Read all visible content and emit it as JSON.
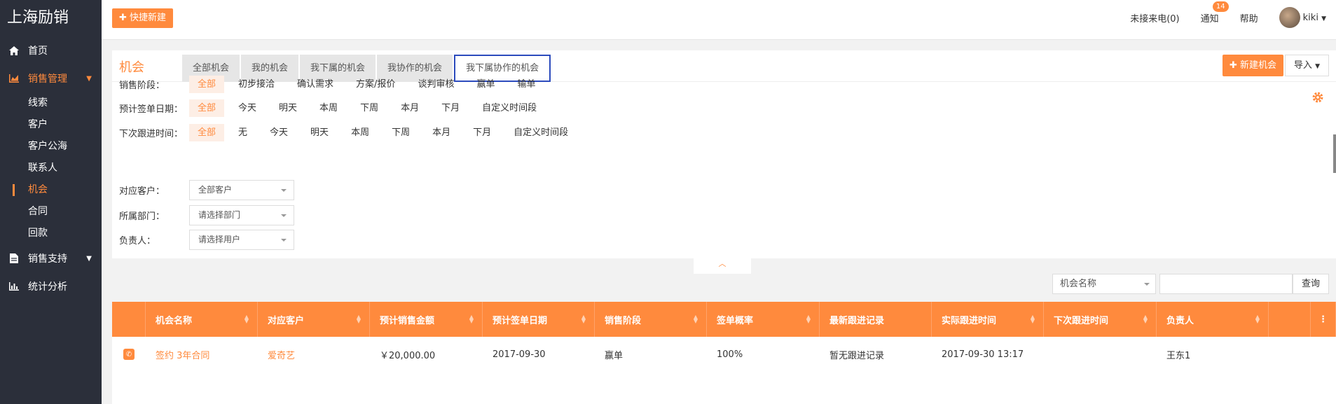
{
  "app": {
    "brand": "上海励销"
  },
  "sidebar": {
    "items": [
      {
        "label": "首页",
        "icon": "home-icon"
      },
      {
        "label": "销售管理",
        "icon": "chart-area-icon"
      },
      {
        "label": "销售支持",
        "icon": "document-icon"
      },
      {
        "label": "统计分析",
        "icon": "bar-chart-icon"
      }
    ],
    "sub_items": [
      "线索",
      "客户",
      "客户公海",
      "联系人",
      "机会",
      "合同",
      "回款"
    ]
  },
  "header": {
    "quick_new": "快捷新建",
    "missed_calls": "未接来电(0)",
    "notice": "通知",
    "notice_count": "14",
    "help": "帮助",
    "user": "kiki"
  },
  "panel": {
    "title": "机会",
    "tabs": [
      "全部机会",
      "我的机会",
      "我下属的机会",
      "我协作的机会",
      "我下属协作的机会"
    ],
    "new_button": "新建机会",
    "import_button": "导入"
  },
  "filters": {
    "stage": {
      "label": "销售阶段：",
      "options": [
        "全部",
        "初步接洽",
        "确认需求",
        "方案/报价",
        "谈判审核",
        "赢单",
        "输单"
      ]
    },
    "sign_date": {
      "label": "预计签单日期：",
      "options": [
        "全部",
        "今天",
        "明天",
        "本周",
        "下周",
        "本月",
        "下月",
        "自定义时间段"
      ]
    },
    "next_follow": {
      "label": "下次跟进时间：",
      "options": [
        "全部",
        "无",
        "今天",
        "明天",
        "本周",
        "下周",
        "本月",
        "下月",
        "自定义时间段"
      ]
    },
    "customer": {
      "label": "对应客户：",
      "value": "全部客户"
    },
    "department": {
      "label": "所属部门：",
      "value": "请选择部门"
    },
    "owner": {
      "label": "负责人：",
      "value": "请选择用户"
    }
  },
  "search": {
    "field": "机会名称",
    "button": "查询"
  },
  "table": {
    "columns": [
      "机会名称",
      "对应客户",
      "预计销售金额",
      "预计签单日期",
      "销售阶段",
      "签单概率",
      "最新跟进记录",
      "实际跟进时间",
      "下次跟进时间",
      "负责人"
    ],
    "rows": [
      [
        "签约 3年合同",
        "爱奇艺",
        "￥20,000.00",
        "2017-09-30",
        "赢单",
        "100%",
        "暂无跟进记录",
        "2017-09-30 13:17",
        "",
        "王东1"
      ]
    ]
  },
  "colors": {
    "accent": "#ff8a3d",
    "sidebar_bg": "#2b2f3a",
    "tab_outline": "#2c4bbd"
  }
}
